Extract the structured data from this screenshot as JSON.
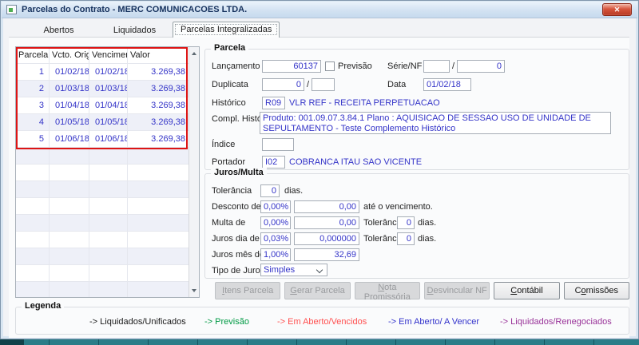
{
  "window": {
    "title": "Parcelas do Contrato - MERC COMUNICACOES LTDA."
  },
  "tabs": [
    {
      "label": "Abertos"
    },
    {
      "label": "Liquidados"
    },
    {
      "label": "Parcelas Integralizadas"
    }
  ],
  "active_tab_index": 2,
  "table": {
    "headers": [
      "Parcela",
      "Vcto. Orig",
      "Vencimento",
      "Valor"
    ],
    "rows": [
      [
        "1",
        "01/02/18",
        "01/02/18",
        "3.269,38"
      ],
      [
        "2",
        "01/03/18",
        "01/03/18",
        "3.269,38"
      ],
      [
        "3",
        "01/04/18",
        "01/04/18",
        "3.269,38"
      ],
      [
        "4",
        "01/05/18",
        "01/05/18",
        "3.269,38"
      ],
      [
        "5",
        "01/06/18",
        "01/06/18",
        "3.269,38"
      ]
    ],
    "empty_row_count": 9
  },
  "parcela": {
    "group_title": "Parcela",
    "lancamento": {
      "label": "Lançamento",
      "value": "60137"
    },
    "previsao": {
      "label": "Previsão",
      "checked": false
    },
    "serie_nf": {
      "label": "Série/NF",
      "value1": "",
      "separator": "/",
      "value2": "0"
    },
    "duplicata": {
      "label": "Duplicata",
      "value1": "0",
      "separator": "/",
      "value2": ""
    },
    "data": {
      "label": "Data",
      "value": "01/02/18"
    },
    "historico": {
      "label": "Histórico",
      "code": "R09",
      "description": "VLR REF - RECEITA PERPETUACAO"
    },
    "compl_historico": {
      "label": "Compl. Histórico",
      "value": "Produto: 001.09.07.3.84.1  Plano : AQUISICAO DE SESSAO USO DE UNIDADE DE SEPULTAMENTO  - Teste Complemento Histórico"
    },
    "indice": {
      "label": "Índice",
      "value": ""
    },
    "portador": {
      "label": "Portador",
      "code": "I02",
      "description": "COBRANCA ITAU SAO VICENTE"
    }
  },
  "juros": {
    "group_title": "Juros/Multa",
    "tolerancia": {
      "label": "Tolerância",
      "value": "0",
      "suffix": "dias."
    },
    "desconto": {
      "label": "Desconto de",
      "percent": "0,00%",
      "value": "0,00",
      "suffix": "até o vencimento."
    },
    "multa": {
      "label": "Multa de",
      "percent": "0,00%",
      "value": "0,00",
      "tolerancia_label": "Tolerância",
      "tolerancia_value": "0",
      "suffix": "dias."
    },
    "juros_dia": {
      "label": "Juros dia de",
      "percent": "0,03%",
      "value": "0,000000",
      "tolerancia_label": "Tolerância",
      "tolerancia_value": "0",
      "suffix": "dias."
    },
    "juros_mes": {
      "label": "Juros mês de",
      "percent": "1,00%",
      "value": "32,69"
    },
    "tipo_juros": {
      "label": "Tipo de Juros",
      "value": "Simples"
    }
  },
  "buttons": [
    {
      "label": "Itens Parcela",
      "mnemonic": 0,
      "enabled": false
    },
    {
      "label": "Gerar Parcela",
      "mnemonic": 0,
      "enabled": false
    },
    {
      "label": "Nota Promissória",
      "mnemonic": 0,
      "enabled": false
    },
    {
      "label": "Desvincular NF",
      "mnemonic": 0,
      "enabled": false
    },
    {
      "label": "Contábil",
      "mnemonic": 0,
      "enabled": true
    },
    {
      "label": "Comissões",
      "mnemonic": 1,
      "enabled": true
    }
  ],
  "legend": {
    "title": "Legenda",
    "items": [
      {
        "label": "-> Liquidados/Unificados",
        "color": "#1a1a1a"
      },
      {
        "label": "-> Previsão",
        "color": "#009a44"
      },
      {
        "label": "-> Em Aberto/Vencidos",
        "color": "#ff5050"
      },
      {
        "label": "-> Em Aberto/ A Vencer",
        "color": "#3333cc"
      },
      {
        "label": "-> Liquidados/Renegociados",
        "color": "#993399"
      }
    ]
  },
  "colors": {
    "field_text": "#3434c8",
    "highlight_border": "#dd1414",
    "row_alt": "#eef0f8",
    "close_button": "#c0392b"
  }
}
